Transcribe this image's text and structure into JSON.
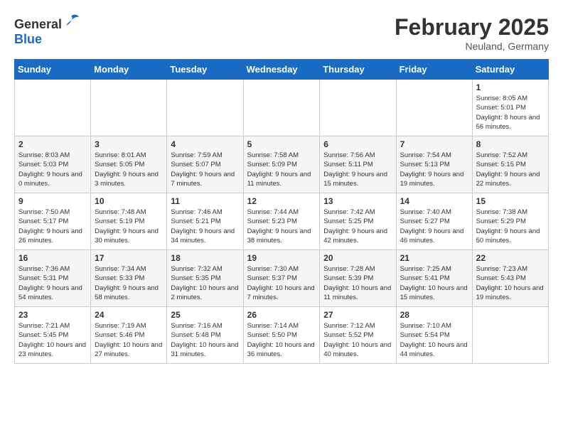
{
  "header": {
    "logo_general": "General",
    "logo_blue": "Blue",
    "month_title": "February 2025",
    "location": "Neuland, Germany"
  },
  "weekdays": [
    "Sunday",
    "Monday",
    "Tuesday",
    "Wednesday",
    "Thursday",
    "Friday",
    "Saturday"
  ],
  "weeks": [
    [
      {
        "day": "",
        "info": ""
      },
      {
        "day": "",
        "info": ""
      },
      {
        "day": "",
        "info": ""
      },
      {
        "day": "",
        "info": ""
      },
      {
        "day": "",
        "info": ""
      },
      {
        "day": "",
        "info": ""
      },
      {
        "day": "1",
        "info": "Sunrise: 8:05 AM\nSunset: 5:01 PM\nDaylight: 8 hours and 56 minutes."
      }
    ],
    [
      {
        "day": "2",
        "info": "Sunrise: 8:03 AM\nSunset: 5:03 PM\nDaylight: 9 hours and 0 minutes."
      },
      {
        "day": "3",
        "info": "Sunrise: 8:01 AM\nSunset: 5:05 PM\nDaylight: 9 hours and 3 minutes."
      },
      {
        "day": "4",
        "info": "Sunrise: 7:59 AM\nSunset: 5:07 PM\nDaylight: 9 hours and 7 minutes."
      },
      {
        "day": "5",
        "info": "Sunrise: 7:58 AM\nSunset: 5:09 PM\nDaylight: 9 hours and 11 minutes."
      },
      {
        "day": "6",
        "info": "Sunrise: 7:56 AM\nSunset: 5:11 PM\nDaylight: 9 hours and 15 minutes."
      },
      {
        "day": "7",
        "info": "Sunrise: 7:54 AM\nSunset: 5:13 PM\nDaylight: 9 hours and 19 minutes."
      },
      {
        "day": "8",
        "info": "Sunrise: 7:52 AM\nSunset: 5:15 PM\nDaylight: 9 hours and 22 minutes."
      }
    ],
    [
      {
        "day": "9",
        "info": "Sunrise: 7:50 AM\nSunset: 5:17 PM\nDaylight: 9 hours and 26 minutes."
      },
      {
        "day": "10",
        "info": "Sunrise: 7:48 AM\nSunset: 5:19 PM\nDaylight: 9 hours and 30 minutes."
      },
      {
        "day": "11",
        "info": "Sunrise: 7:46 AM\nSunset: 5:21 PM\nDaylight: 9 hours and 34 minutes."
      },
      {
        "day": "12",
        "info": "Sunrise: 7:44 AM\nSunset: 5:23 PM\nDaylight: 9 hours and 38 minutes."
      },
      {
        "day": "13",
        "info": "Sunrise: 7:42 AM\nSunset: 5:25 PM\nDaylight: 9 hours and 42 minutes."
      },
      {
        "day": "14",
        "info": "Sunrise: 7:40 AM\nSunset: 5:27 PM\nDaylight: 9 hours and 46 minutes."
      },
      {
        "day": "15",
        "info": "Sunrise: 7:38 AM\nSunset: 5:29 PM\nDaylight: 9 hours and 50 minutes."
      }
    ],
    [
      {
        "day": "16",
        "info": "Sunrise: 7:36 AM\nSunset: 5:31 PM\nDaylight: 9 hours and 54 minutes."
      },
      {
        "day": "17",
        "info": "Sunrise: 7:34 AM\nSunset: 5:33 PM\nDaylight: 9 hours and 58 minutes."
      },
      {
        "day": "18",
        "info": "Sunrise: 7:32 AM\nSunset: 5:35 PM\nDaylight: 10 hours and 2 minutes."
      },
      {
        "day": "19",
        "info": "Sunrise: 7:30 AM\nSunset: 5:37 PM\nDaylight: 10 hours and 7 minutes."
      },
      {
        "day": "20",
        "info": "Sunrise: 7:28 AM\nSunset: 5:39 PM\nDaylight: 10 hours and 11 minutes."
      },
      {
        "day": "21",
        "info": "Sunrise: 7:25 AM\nSunset: 5:41 PM\nDaylight: 10 hours and 15 minutes."
      },
      {
        "day": "22",
        "info": "Sunrise: 7:23 AM\nSunset: 5:43 PM\nDaylight: 10 hours and 19 minutes."
      }
    ],
    [
      {
        "day": "23",
        "info": "Sunrise: 7:21 AM\nSunset: 5:45 PM\nDaylight: 10 hours and 23 minutes."
      },
      {
        "day": "24",
        "info": "Sunrise: 7:19 AM\nSunset: 5:46 PM\nDaylight: 10 hours and 27 minutes."
      },
      {
        "day": "25",
        "info": "Sunrise: 7:16 AM\nSunset: 5:48 PM\nDaylight: 10 hours and 31 minutes."
      },
      {
        "day": "26",
        "info": "Sunrise: 7:14 AM\nSunset: 5:50 PM\nDaylight: 10 hours and 36 minutes."
      },
      {
        "day": "27",
        "info": "Sunrise: 7:12 AM\nSunset: 5:52 PM\nDaylight: 10 hours and 40 minutes."
      },
      {
        "day": "28",
        "info": "Sunrise: 7:10 AM\nSunset: 5:54 PM\nDaylight: 10 hours and 44 minutes."
      },
      {
        "day": "",
        "info": ""
      }
    ]
  ]
}
